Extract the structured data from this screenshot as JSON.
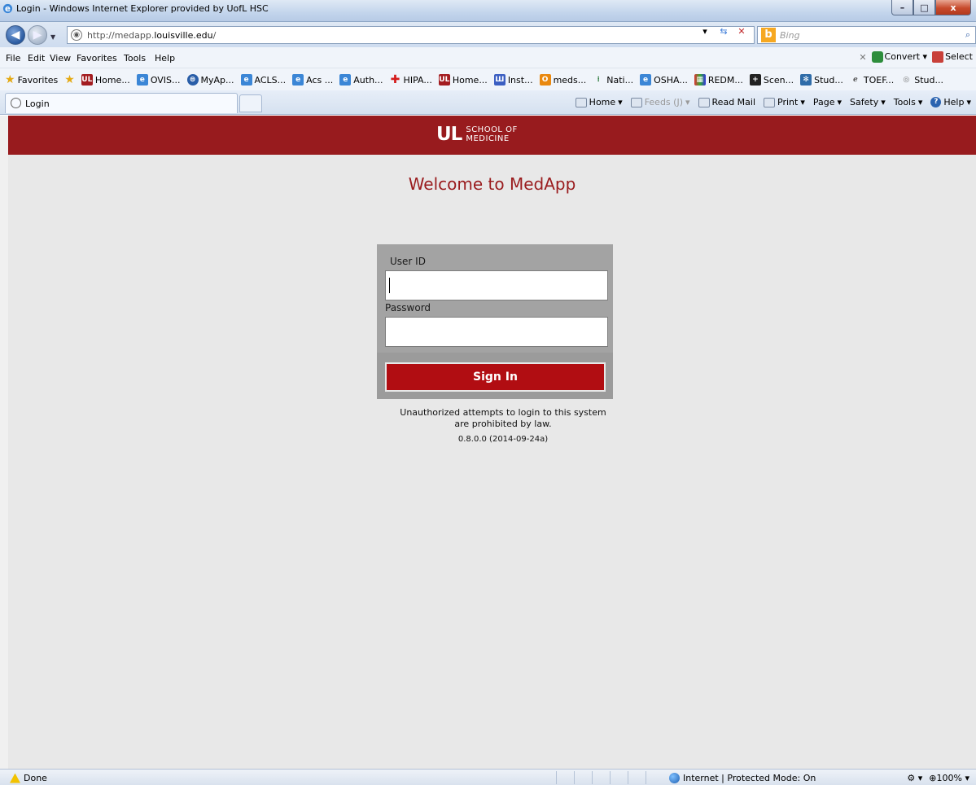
{
  "window": {
    "title": "Login - Windows Internet Explorer provided by UofL HSC",
    "minimize": "–",
    "maximize": "□",
    "close": "x"
  },
  "address": {
    "url_prefix": "http://medapp.",
    "url_domain": "louisville.edu",
    "url_suffix": "/",
    "search_placeholder": "Bing"
  },
  "menu": {
    "items": [
      "File",
      "Edit",
      "View",
      "Favorites",
      "Tools",
      "Help"
    ],
    "convert_label": "Convert",
    "select_label": "Select"
  },
  "favorites": {
    "label": "Favorites",
    "items": [
      "Home...",
      "OVIS...",
      "MyAp...",
      "ACLS...",
      "Acs ...",
      "Auth...",
      "HIPA...",
      "Home...",
      "Inst...",
      "meds...",
      "Nati...",
      "OSHA...",
      "REDM...",
      "Scen...",
      "Stud...",
      "TOEF...",
      "Stud..."
    ]
  },
  "tab": {
    "title": "Login"
  },
  "command_bar": {
    "home": "Home",
    "feeds": "Feeds (J)",
    "read_mail": "Read Mail",
    "print": "Print",
    "page": "Page",
    "safety": "Safety",
    "tools": "Tools",
    "help": "Help"
  },
  "page": {
    "logo_mark": "UL",
    "logo_text_1": "SCHOOL OF",
    "logo_text_2": "MEDICINE",
    "welcome": "Welcome to MedApp",
    "user_id_label": "User ID",
    "user_id_value": "",
    "password_label": "Password",
    "password_value": "",
    "sign_in": "Sign In",
    "notice_line_1": "Unauthorized attempts to login to this system",
    "notice_line_2": "are prohibited by law.",
    "version": "0.8.0.0 (2014-09-24a)",
    "brand_color": "#981b1e",
    "button_color": "#b10d12"
  },
  "status": {
    "text": "Done",
    "zone": "Internet | Protected Mode: On",
    "zoom": "100%"
  }
}
